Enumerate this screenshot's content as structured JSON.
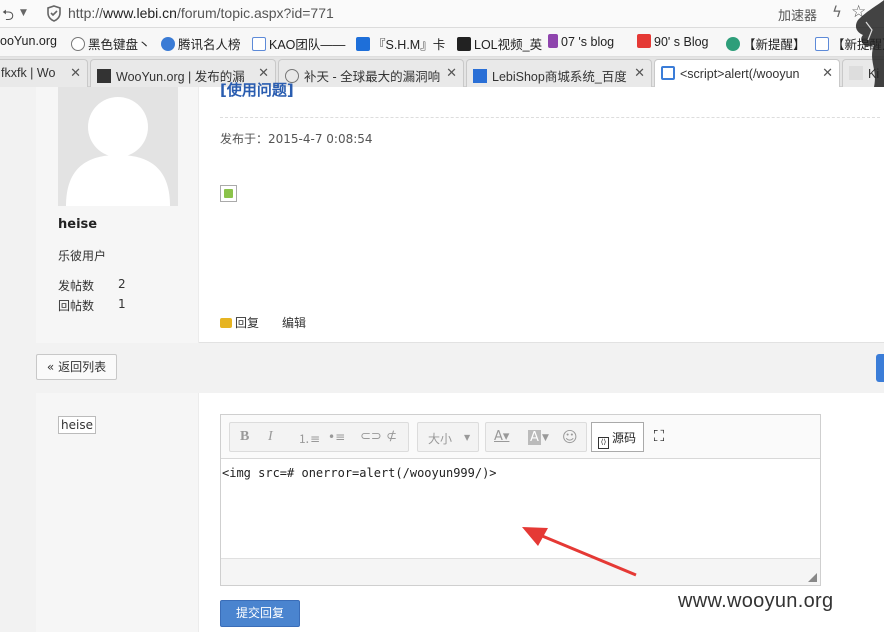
{
  "browser": {
    "url_prefix": "http://",
    "url_host": "www.lebi.cn",
    "url_path": "/forum/topic.aspx?id=771",
    "accelerator": "加速器"
  },
  "bookmarks": [
    {
      "label": "ooYun.org",
      "icon": "site-icon"
    },
    {
      "label": "黑色键盘丶",
      "icon": "star-icon"
    },
    {
      "label": "腾讯名人榜",
      "icon": "shield-icon"
    },
    {
      "label": "KAO团队——",
      "icon": "page-icon"
    },
    {
      "label": "『S.H.M』卡",
      "icon": "site-icon"
    },
    {
      "label": "LOL视频_英",
      "icon": "site-icon"
    },
    {
      "label": "07 's blog",
      "icon": "site-icon"
    },
    {
      "label": "90' s Blog",
      "icon": "site-icon"
    },
    {
      "label": "【新提醒】",
      "icon": "site-icon"
    },
    {
      "label": "【新提醒】",
      "icon": "page-icon"
    }
  ],
  "tabs": [
    {
      "label": "fkxfk | Wo"
    },
    {
      "label": "WooYun.org | 发布的漏"
    },
    {
      "label": "补天 - 全球最大的漏洞响"
    },
    {
      "label": "LebiShop商城系统_百度"
    },
    {
      "label": "<script>alert(/wooyun"
    },
    {
      "label": "Ki"
    }
  ],
  "post": {
    "title": "[使用问题]",
    "date": "发布于：2015-4-7 0:08:54",
    "author": {
      "name": "heise",
      "group": "乐彼用户",
      "stats": [
        {
          "label": "发帖数",
          "value": "2"
        },
        {
          "label": "回帖数",
          "value": "1"
        }
      ]
    },
    "actions": {
      "reply": "回复",
      "edit": "编辑"
    }
  },
  "back_button": "« 返回列表",
  "reply_form": {
    "username": "heise",
    "toolbar": {
      "font_size": "大小",
      "source": "源码"
    },
    "content": "<img src=# onerror=alert(/wooyun999/)>",
    "submit": "提交回复"
  },
  "watermark": "www.wooyun.org",
  "colors": {
    "link_blue": "#2a5db0",
    "button_blue": "#4a84cf",
    "arrow_red": "#e53935"
  }
}
